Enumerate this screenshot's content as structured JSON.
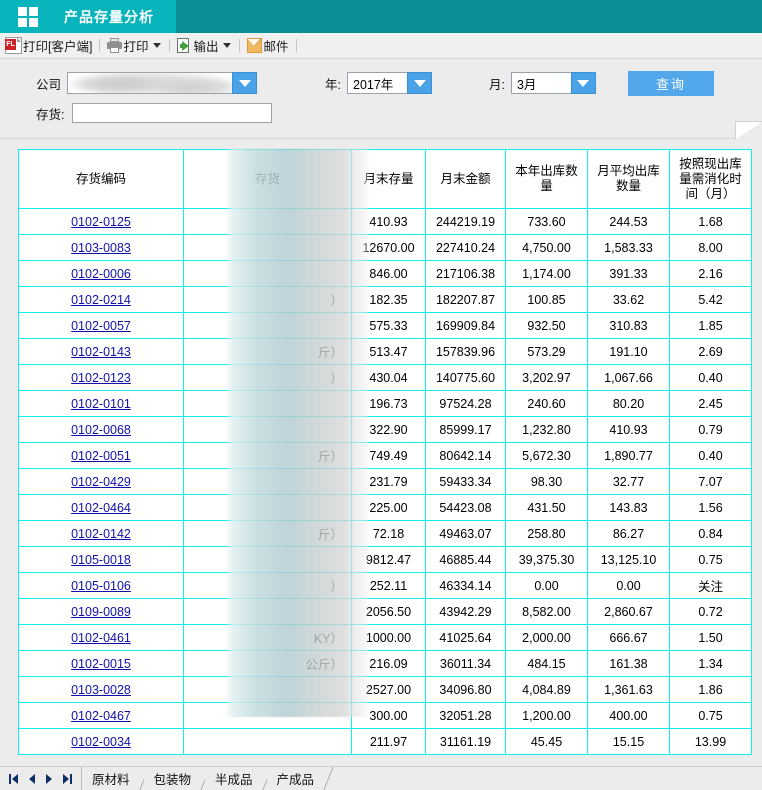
{
  "titlebar": {
    "logo_icon": "grid-logo-icon",
    "active_tab": "产品存量分析"
  },
  "toolbar": {
    "items": [
      {
        "label": "打印[客户端]",
        "icon": "flash-print-icon",
        "dropdown": false
      },
      {
        "label": "打印",
        "icon": "printer-icon",
        "dropdown": true
      },
      {
        "label": "输出",
        "icon": "export-icon",
        "dropdown": true
      },
      {
        "label": "邮件",
        "icon": "mail-icon",
        "dropdown": false
      }
    ]
  },
  "filters": {
    "company_label": "公司",
    "company_value": "",
    "inventory_label": "存货:",
    "inventory_value": "",
    "year_label": "年:",
    "year_value": "2017年",
    "month_label": "月:",
    "month_value": "3月",
    "query_label": "查询",
    "accent_color": "#53a8ec"
  },
  "table": {
    "grid_color": "#12efef",
    "link_color": "#1111aa",
    "headers": [
      "存货编码",
      "存货",
      "月末存量",
      "月末金额",
      "本年出库数量",
      "月平均出库数量",
      "按照现出库量需消化时间（月）"
    ],
    "rows": [
      {
        "code": "0102-0125",
        "name": "",
        "stock": "410.93",
        "amount": "244219.19",
        "year_out": "733.60",
        "month_avg": "244.53",
        "months": "1.68"
      },
      {
        "code": "0103-0083",
        "name": "",
        "stock": "12670.00",
        "amount": "227410.24",
        "year_out": "4,750.00",
        "month_avg": "1,583.33",
        "months": "8.00"
      },
      {
        "code": "0102-0006",
        "name": "",
        "stock": "846.00",
        "amount": "217106.38",
        "year_out": "1,174.00",
        "month_avg": "391.33",
        "months": "2.16"
      },
      {
        "code": "0102-0214",
        "name": "）",
        "stock": "182.35",
        "amount": "182207.87",
        "year_out": "100.85",
        "month_avg": "33.62",
        "months": "5.42"
      },
      {
        "code": "0102-0057",
        "name": "",
        "stock": "575.33",
        "amount": "169909.84",
        "year_out": "932.50",
        "month_avg": "310.83",
        "months": "1.85"
      },
      {
        "code": "0102-0143",
        "name": "斤）",
        "stock": "513.47",
        "amount": "157839.96",
        "year_out": "573.29",
        "month_avg": "191.10",
        "months": "2.69"
      },
      {
        "code": "0102-0123",
        "name": "）",
        "stock": "430.04",
        "amount": "140775.60",
        "year_out": "3,202.97",
        "month_avg": "1,067.66",
        "months": "0.40"
      },
      {
        "code": "0102-0101",
        "name": "",
        "stock": "196.73",
        "amount": "97524.28",
        "year_out": "240.60",
        "month_avg": "80.20",
        "months": "2.45"
      },
      {
        "code": "0102-0068",
        "name": "",
        "stock": "322.90",
        "amount": "85999.17",
        "year_out": "1,232.80",
        "month_avg": "410.93",
        "months": "0.79"
      },
      {
        "code": "0102-0051",
        "name": "斤）",
        "stock": "749.49",
        "amount": "80642.14",
        "year_out": "5,672.30",
        "month_avg": "1,890.77",
        "months": "0.40"
      },
      {
        "code": "0102-0429",
        "name": "",
        "stock": "231.79",
        "amount": "59433.34",
        "year_out": "98.30",
        "month_avg": "32.77",
        "months": "7.07"
      },
      {
        "code": "0102-0464",
        "name": "",
        "stock": "225.00",
        "amount": "54423.08",
        "year_out": "431.50",
        "month_avg": "143.83",
        "months": "1.56"
      },
      {
        "code": "0102-0142",
        "name": "斤）",
        "stock": "72.18",
        "amount": "49463.07",
        "year_out": "258.80",
        "month_avg": "86.27",
        "months": "0.84"
      },
      {
        "code": "0105-0018",
        "name": "",
        "stock": "9812.47",
        "amount": "46885.44",
        "year_out": "39,375.30",
        "month_avg": "13,125.10",
        "months": "0.75"
      },
      {
        "code": "0105-0106",
        "name": "）",
        "stock": "252.11",
        "amount": "46334.14",
        "year_out": "0.00",
        "month_avg": "0.00",
        "months": "关注"
      },
      {
        "code": "0109-0089",
        "name": "",
        "stock": "2056.50",
        "amount": "43942.29",
        "year_out": "8,582.00",
        "month_avg": "2,860.67",
        "months": "0.72"
      },
      {
        "code": "0102-0461",
        "name": "KY）",
        "stock": "1000.00",
        "amount": "41025.64",
        "year_out": "2,000.00",
        "month_avg": "666.67",
        "months": "1.50"
      },
      {
        "code": "0102-0015",
        "name": "公斤）",
        "stock": "216.09",
        "amount": "36011.34",
        "year_out": "484.15",
        "month_avg": "161.38",
        "months": "1.34"
      },
      {
        "code": "0103-0028",
        "name": "",
        "stock": "2527.00",
        "amount": "34096.80",
        "year_out": "4,084.89",
        "month_avg": "1,361.63",
        "months": "1.86"
      },
      {
        "code": "0102-0467",
        "name": "",
        "stock": "300.00",
        "amount": "32051.28",
        "year_out": "1,200.00",
        "month_avg": "400.00",
        "months": "0.75"
      },
      {
        "code": "0102-0034",
        "name": "",
        "stock": "211.97",
        "amount": "31161.19",
        "year_out": "45.45",
        "month_avg": "15.15",
        "months": "13.99"
      }
    ]
  },
  "bottom": {
    "nav": [
      "first-record-icon",
      "previous-record-icon",
      "next-record-icon",
      "last-record-icon"
    ],
    "sheets": [
      {
        "label": "原材料",
        "active": true
      },
      {
        "label": "包装物",
        "active": false
      },
      {
        "label": "半成品",
        "active": false
      },
      {
        "label": "产成品",
        "active": false
      }
    ]
  }
}
